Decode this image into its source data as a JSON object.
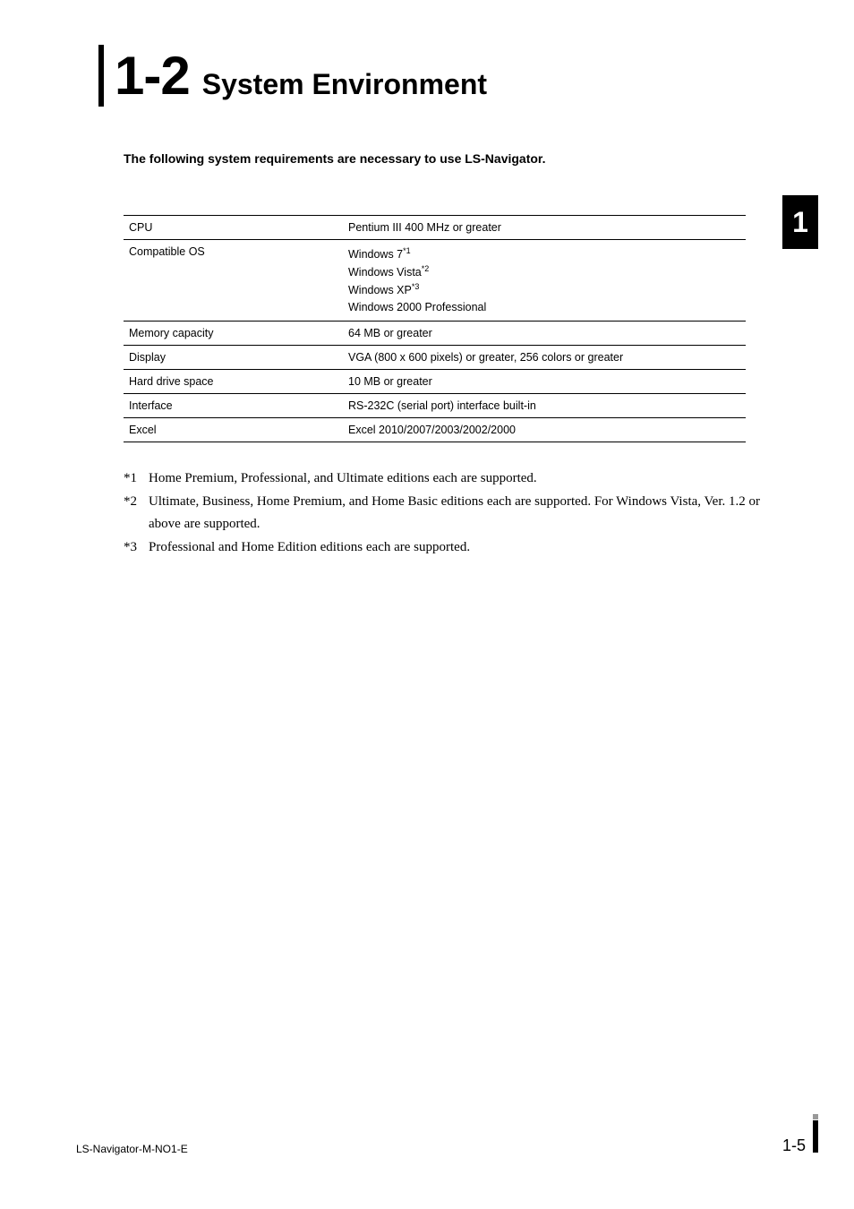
{
  "heading": {
    "number": "1-2",
    "title": "System Environment"
  },
  "intro": "The following system requirements are necessary to use LS-Navigator.",
  "table": {
    "rows": [
      {
        "label": "CPU",
        "value": "Pentium III 400 MHz or greater"
      }
    ],
    "os_row": {
      "label": "Compatible OS",
      "lines": [
        {
          "text": "Windows 7",
          "sup": "*1"
        },
        {
          "text": "Windows Vista",
          "sup": "*2"
        },
        {
          "text": "Windows XP",
          "sup": "*3"
        },
        {
          "text": "Windows 2000 Professional",
          "sup": ""
        }
      ]
    },
    "rows2": [
      {
        "label": "Memory capacity",
        "value": "64 MB or greater"
      },
      {
        "label": "Display",
        "value": "VGA (800 x 600 pixels) or greater, 256 colors or greater"
      },
      {
        "label": "Hard drive space",
        "value": "10 MB or greater"
      },
      {
        "label": "Interface",
        "value": "RS-232C (serial port) interface built-in"
      },
      {
        "label": "Excel",
        "value": "Excel 2010/2007/2003/2002/2000"
      }
    ]
  },
  "footnotes": [
    {
      "mark": "*1",
      "text": "Home Premium, Professional, and Ultimate editions each are supported."
    },
    {
      "mark": "*2",
      "text": "Ultimate, Business, Home Premium, and Home Basic editions each are supported. For Windows Vista, Ver. 1.2 or above are supported."
    },
    {
      "mark": "*3",
      "text": "Professional and Home Edition editions each are supported."
    }
  ],
  "chapter_tab": "1",
  "footer": {
    "doc_id": "LS-Navigator-M-NO1-E",
    "page": "1-5"
  }
}
